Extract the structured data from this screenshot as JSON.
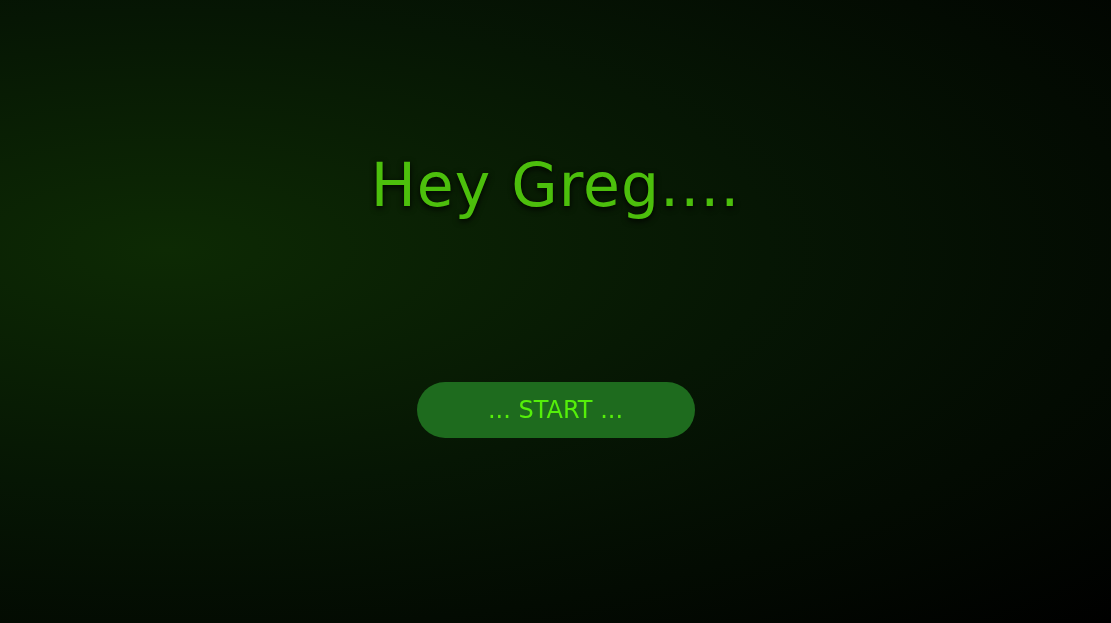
{
  "greeting": "Hey Greg....",
  "start_button": {
    "label": "... START ..."
  }
}
